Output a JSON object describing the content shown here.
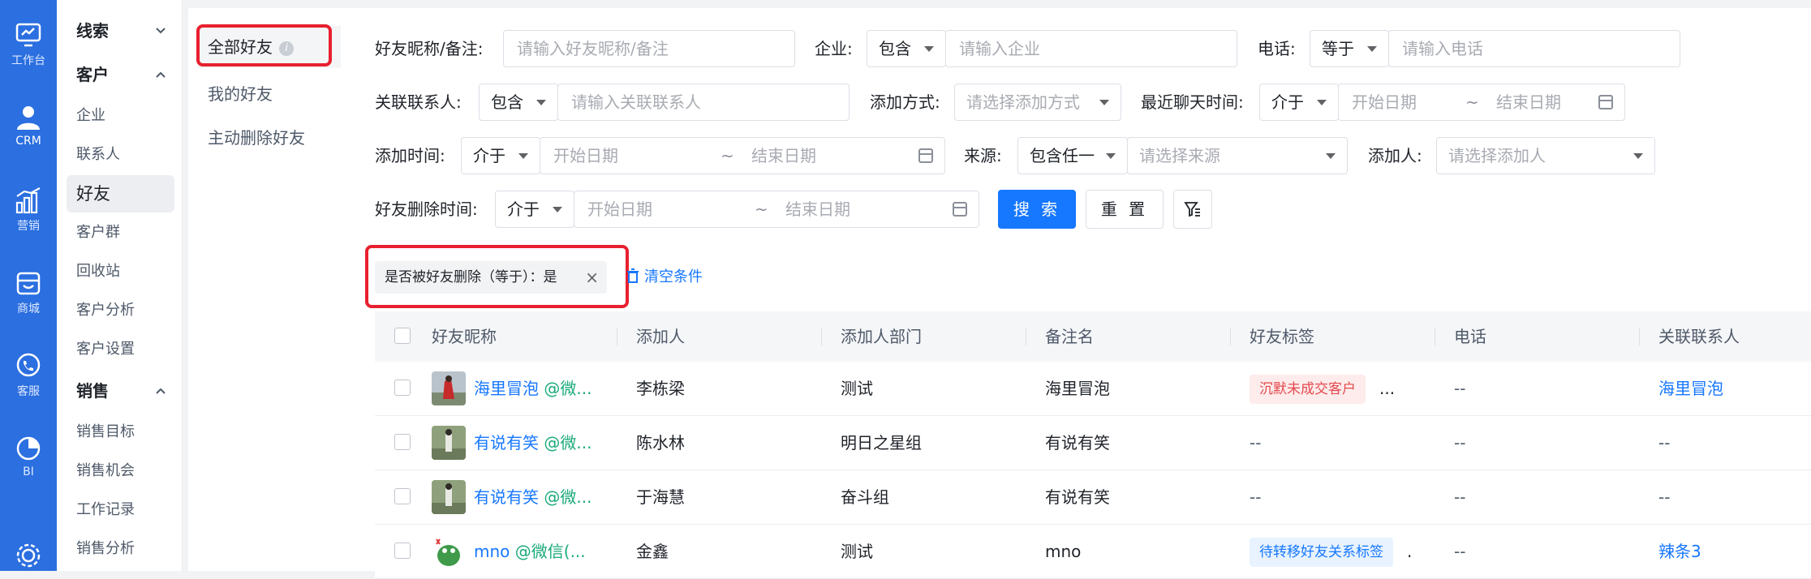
{
  "rail": [
    {
      "label": "工作台",
      "icon": "monitor-icon"
    },
    {
      "label": "CRM",
      "icon": "person-icon"
    },
    {
      "label": "营销",
      "icon": "chart-bars-icon"
    },
    {
      "label": "商城",
      "icon": "store-icon"
    },
    {
      "label": "客服",
      "icon": "phone-chat-icon"
    },
    {
      "label": "BI",
      "icon": "pie-icon"
    }
  ],
  "nav": {
    "groups": [
      {
        "label": "线索",
        "items": []
      },
      {
        "label": "客户",
        "items": [
          "企业",
          "联系人",
          "好友",
          "客户群",
          "回收站",
          "客户分析",
          "客户设置"
        ]
      },
      {
        "label": "销售",
        "items": [
          "销售目标",
          "销售机会",
          "工作记录",
          "销售分析"
        ]
      }
    ],
    "active_item": "好友"
  },
  "subnav": {
    "items": [
      "全部好友",
      "我的好友",
      "主动删除好友"
    ],
    "active": "全部好友",
    "info_glyph": "i"
  },
  "filters": {
    "nickname": {
      "label": "好友昵称/备注:",
      "placeholder": "请输入好友昵称/备注"
    },
    "company": {
      "label": "企业:",
      "operator": "包含",
      "placeholder": "请输入企业"
    },
    "phone": {
      "label": "电话:",
      "operator": "等于",
      "placeholder": "请输入电话"
    },
    "contact": {
      "label": "关联联系人:",
      "operator": "包含",
      "placeholder": "请输入关联联系人"
    },
    "add_method": {
      "label": "添加方式:",
      "placeholder": "请选择添加方式"
    },
    "last_chat": {
      "label": "最近聊天时间:",
      "operator": "介于",
      "start": "开始日期",
      "end": "结束日期",
      "sep": "~"
    },
    "add_time": {
      "label": "添加时间:",
      "operator": "介于",
      "start": "开始日期",
      "end": "结束日期",
      "sep": "~"
    },
    "source": {
      "label": "来源:",
      "operator": "包含任一",
      "placeholder": "请选择来源"
    },
    "adder": {
      "label": "添加人:",
      "placeholder": "请选择添加人"
    },
    "delete_time": {
      "label": "好友删除时间:",
      "operator": "介于",
      "start": "开始日期",
      "end": "结束日期",
      "sep": "~"
    },
    "search_button": "搜 索",
    "reset_button": "重 置"
  },
  "active_filter": {
    "text": "是否被好友删除（等于）：是",
    "close": "×"
  },
  "clear_conditions": "清空条件",
  "table": {
    "columns": [
      "好友昵称",
      "添加人",
      "添加人部门",
      "备注名",
      "好友标签",
      "电话",
      "关联联系人"
    ],
    "rows": [
      {
        "name": "海里冒泡",
        "wx": "@微...",
        "adder": "李栋梁",
        "dept": "测试",
        "remark": "海里冒泡",
        "tag": "沉默未成交客户",
        "tag_color": "red",
        "tag_more": "...",
        "phone": "--",
        "contact": "海里冒泡",
        "contact_link": true
      },
      {
        "name": "有说有笑",
        "wx": "@微...",
        "adder": "陈水林",
        "dept": "明日之星组",
        "remark": "有说有笑",
        "tag": "--",
        "tag_color": "",
        "tag_more": "",
        "phone": "--",
        "contact": "--",
        "contact_link": false
      },
      {
        "name": "有说有笑",
        "wx": "@微...",
        "adder": "于海慧",
        "dept": "奋斗组",
        "remark": "有说有笑",
        "tag": "--",
        "tag_color": "",
        "tag_more": "",
        "phone": "--",
        "contact": "--",
        "contact_link": false
      },
      {
        "name": "mno",
        "wx": "@微信(...",
        "adder": "金鑫",
        "dept": "测试",
        "remark": "mno",
        "tag": "待转移好友关系标签",
        "tag_color": "blue",
        "tag_more": ".",
        "phone": "--",
        "contact": "辣条3",
        "contact_link": true
      }
    ]
  },
  "colors": {
    "rail": "#2b6fe0",
    "primary": "#1677ff",
    "highlight": "#e8202f"
  }
}
